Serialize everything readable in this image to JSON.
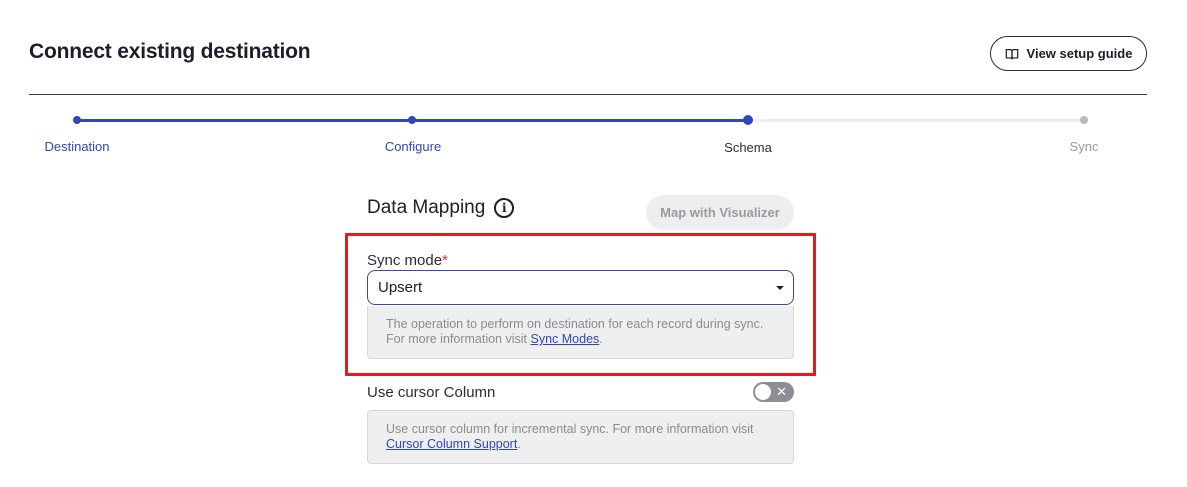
{
  "header": {
    "title": "Connect existing destination",
    "guide_button": "View setup guide",
    "guide_icon": "book-icon"
  },
  "stepper": {
    "steps": [
      {
        "label": "Destination",
        "state": "done"
      },
      {
        "label": "Configure",
        "state": "done"
      },
      {
        "label": "Schema",
        "state": "current"
      },
      {
        "label": "Sync",
        "state": "todo"
      }
    ]
  },
  "mapping": {
    "title": "Data Mapping",
    "info_icon": "info-icon",
    "visualizer_button": "Map with Visualizer"
  },
  "sync_mode": {
    "label": "Sync mode",
    "required_mark": "*",
    "value": "Upsert",
    "help_text": "The operation to perform on destination for each record during sync. For more information visit ",
    "help_link": "Sync Modes",
    "help_suffix": "."
  },
  "cursor": {
    "label": "Use cursor Column",
    "toggle_state": "off",
    "toggle_mark": "✕",
    "help_text": "Use cursor column for incremental sync. For more information visit ",
    "help_link": "Cursor Column Support",
    "help_suffix": "."
  },
  "colors": {
    "accent": "#3146b8",
    "highlight": "#e01e1e",
    "required": "#d43030"
  }
}
